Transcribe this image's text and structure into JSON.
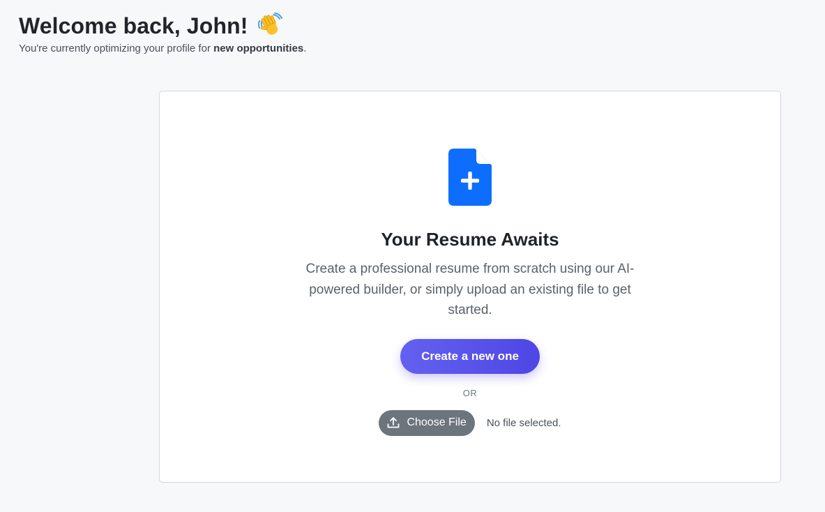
{
  "header": {
    "welcome_title": "Welcome back, John!",
    "wave_icon": "waving-hand-icon",
    "subtitle_prefix": "You're currently optimizing your profile for ",
    "subtitle_bold": "new opportunities",
    "subtitle_suffix": "."
  },
  "resume_card": {
    "icon": "file-plus-icon",
    "title": "Your Resume Awaits",
    "description": "Create a professional resume from scratch using our AI-powered builder, or simply upload an existing file to get started.",
    "create_button_label": "Create a new one",
    "or_label": "OR",
    "choose_file_label": "Choose File",
    "upload_icon": "upload-icon",
    "file_status": "No file selected."
  },
  "colors": {
    "accent": "#4f46e5",
    "accent_light": "#6361f0",
    "icon_blue": "#0d6efd",
    "secondary_button": "#6c747c",
    "background": "#f7f8fa"
  }
}
